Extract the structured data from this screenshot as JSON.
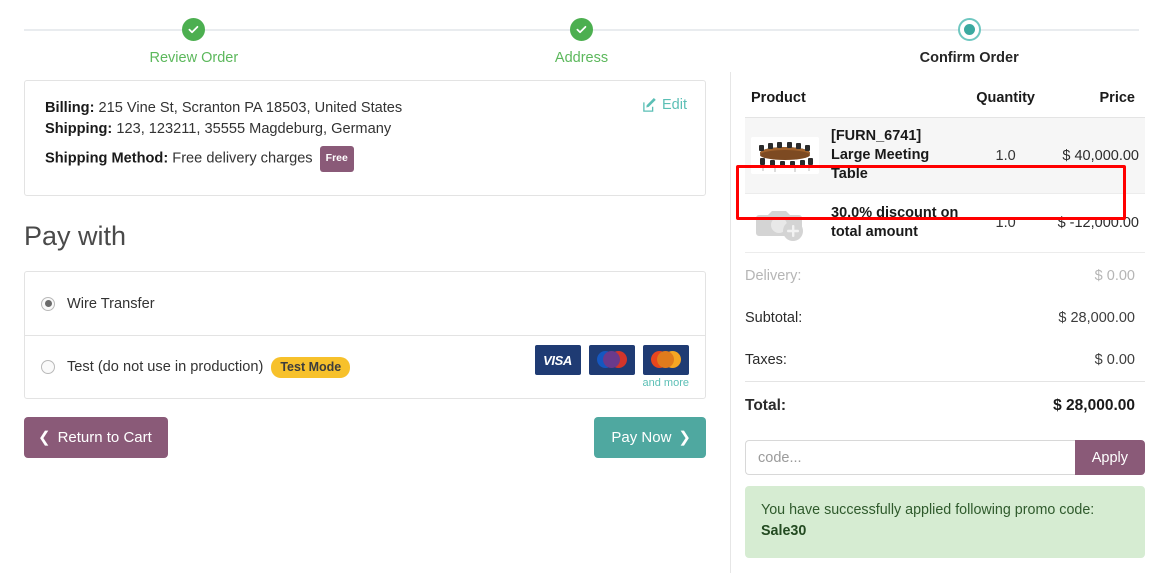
{
  "stepper": {
    "steps": [
      {
        "label": "Review Order",
        "state": "done"
      },
      {
        "label": "Address",
        "state": "done"
      },
      {
        "label": "Confirm Order",
        "state": "active"
      }
    ]
  },
  "address": {
    "billing_label": "Billing:",
    "billing_value": "215 Vine St, Scranton PA 18503, United States",
    "shipping_label": "Shipping:",
    "shipping_value": "123, 123211, 35555 Magdeburg, Germany",
    "method_label": "Shipping Method:",
    "method_value": "Free delivery charges",
    "method_badge": "Free",
    "edit_label": "Edit"
  },
  "payment": {
    "title": "Pay with",
    "options": [
      {
        "label": "Wire Transfer",
        "selected": true,
        "badge": null
      },
      {
        "label": "Test (do not use in production)",
        "selected": false,
        "badge": "Test Mode"
      }
    ],
    "cards": [
      "VISA",
      "Maestro",
      "MasterCard"
    ],
    "and_more": "and more"
  },
  "actions": {
    "return_label": "Return to Cart",
    "pay_label": "Pay Now"
  },
  "order": {
    "columns": {
      "product": "Product",
      "quantity": "Quantity",
      "price": "Price"
    },
    "lines": [
      {
        "name": "[FURN_6741] Large Meeting Table",
        "quantity": "1.0",
        "price": "$ 40,000.00",
        "image": "meeting-table-photo",
        "highlighted": false
      },
      {
        "name": "30.0% discount on total amount",
        "quantity": "1.0",
        "price": "$ -12,000.00",
        "image": "image-placeholder-icon",
        "highlighted": true
      }
    ],
    "totals": [
      {
        "label": "Delivery:",
        "value": "$ 0.00",
        "muted": true,
        "grand": false
      },
      {
        "label": "Subtotal:",
        "value": "$ 28,000.00",
        "muted": false,
        "grand": false
      },
      {
        "label": "Taxes:",
        "value": "$ 0.00",
        "muted": false,
        "grand": false
      },
      {
        "label": "Total:",
        "value": "$ 28,000.00",
        "muted": false,
        "grand": true
      }
    ]
  },
  "promo": {
    "placeholder": "code...",
    "value": "",
    "apply_label": "Apply",
    "message_text": "You have successfully applied following promo code:",
    "message_code": "Sale30"
  },
  "colors": {
    "done_green": "#4caf50",
    "active_teal": "#3aa9a0",
    "purple": "#8a5a78",
    "pay_teal": "#4fa8a0",
    "badge_yellow": "#f7c12b",
    "highlight_red": "#ff0000",
    "success_bg": "#d6ecd2"
  }
}
